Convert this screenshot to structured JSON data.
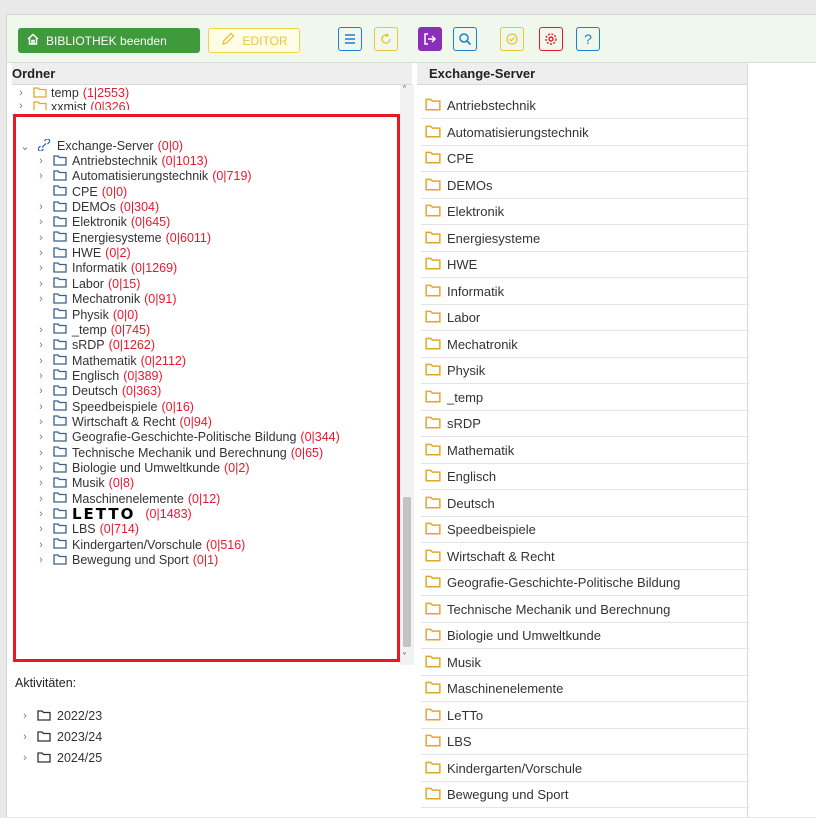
{
  "toolbar": {
    "exit_label": "BIBLIOTHEK beenden",
    "editor_label": "EDITOR",
    "icons": [
      {
        "name": "list-icon",
        "color": "#1a7fd1"
      },
      {
        "name": "refresh-icon",
        "color": "#e8c739"
      },
      {
        "name": "logout-icon",
        "color": "#8b2fb8"
      },
      {
        "name": "search-icon",
        "color": "#1a7fd1"
      },
      {
        "name": "check-circle-icon",
        "color": "#e8c739"
      },
      {
        "name": "settings-icon",
        "color": "#e41b23"
      },
      {
        "name": "help-icon",
        "color": "#1a7fd1"
      }
    ]
  },
  "left": {
    "title": "Ordner",
    "top_items": [
      {
        "label": "temp",
        "count": "(1|2553)"
      },
      {
        "label": "xxmist",
        "count": "(0|326)"
      }
    ],
    "root": {
      "label": "Exchange-Server",
      "count": "(0|0)"
    },
    "children": [
      {
        "label": "Antriebstechnik",
        "count": "(0|1013)",
        "expandable": true
      },
      {
        "label": "Automatisierungstechnik",
        "count": "(0|719)",
        "expandable": true
      },
      {
        "label": "CPE",
        "count": "(0|0)",
        "expandable": false
      },
      {
        "label": "DEMOs",
        "count": "(0|304)",
        "expandable": true
      },
      {
        "label": "Elektronik",
        "count": "(0|645)",
        "expandable": true
      },
      {
        "label": "Energiesysteme",
        "count": "(0|6011)",
        "expandable": true
      },
      {
        "label": "HWE",
        "count": "(0|2)",
        "expandable": true
      },
      {
        "label": "Informatik",
        "count": "(0|1269)",
        "expandable": true
      },
      {
        "label": "Labor",
        "count": "(0|15)",
        "expandable": true
      },
      {
        "label": "Mechatronik",
        "count": "(0|91)",
        "expandable": true
      },
      {
        "label": "Physik",
        "count": "(0|0)",
        "expandable": false
      },
      {
        "label": "_temp",
        "count": "(0|745)",
        "expandable": true
      },
      {
        "label": "sRDP",
        "count": "(0|1262)",
        "expandable": true
      },
      {
        "label": "Mathematik",
        "count": "(0|2112)",
        "expandable": true
      },
      {
        "label": "Englisch",
        "count": "(0|389)",
        "expandable": true
      },
      {
        "label": "Deutsch",
        "count": "(0|363)",
        "expandable": true
      },
      {
        "label": "Speedbeispiele",
        "count": "(0|16)",
        "expandable": true
      },
      {
        "label": "Wirtschaft & Recht",
        "count": "(0|94)",
        "expandable": true
      },
      {
        "label": "Geografie-Geschichte-Politische Bildung",
        "count": "(0|344)",
        "expandable": true
      },
      {
        "label": "Technische Mechanik und Berechnung",
        "count": "(0|65)",
        "expandable": true
      },
      {
        "label": "Biologie und Umweltkunde",
        "count": "(0|2)",
        "expandable": true
      },
      {
        "label": "Musik",
        "count": "(0|8)",
        "expandable": true
      },
      {
        "label": "Maschinenelemente",
        "count": "(0|12)",
        "expandable": true
      },
      {
        "label": "LETTO",
        "count": "(0|1483)",
        "expandable": true,
        "logo": true
      },
      {
        "label": "LBS",
        "count": "(0|714)",
        "expandable": true
      },
      {
        "label": "Kindergarten/Vorschule",
        "count": "(0|516)",
        "expandable": true
      },
      {
        "label": "Bewegung und Sport",
        "count": "(0|1)",
        "expandable": true
      }
    ]
  },
  "activities": {
    "title": "Aktivitäten:",
    "items": [
      "2022/23",
      "2023/24",
      "2024/25"
    ]
  },
  "right": {
    "title": "Exchange-Server",
    "items": [
      "Antriebstechnik",
      "Automatisierungstechnik",
      "CPE",
      "DEMOs",
      "Elektronik",
      "Energiesysteme",
      "HWE",
      "Informatik",
      "Labor",
      "Mechatronik",
      "Physik",
      "_temp",
      "sRDP",
      "Mathematik",
      "Englisch",
      "Deutsch",
      "Speedbeispiele",
      "Wirtschaft & Recht",
      "Geografie-Geschichte-Politische Bildung",
      "Technische Mechanik und Berechnung",
      "Biologie und Umweltkunde",
      "Musik",
      "Maschinenelemente",
      "LeTTo",
      "LBS",
      "Kindergarten/Vorschule",
      "Bewegung und Sport"
    ]
  },
  "colors": {
    "accent_green": "#3f9a3b",
    "count_red": "#e8192c",
    "folder_yellow": "#e2a72a",
    "highlight_red": "#e41b23"
  }
}
